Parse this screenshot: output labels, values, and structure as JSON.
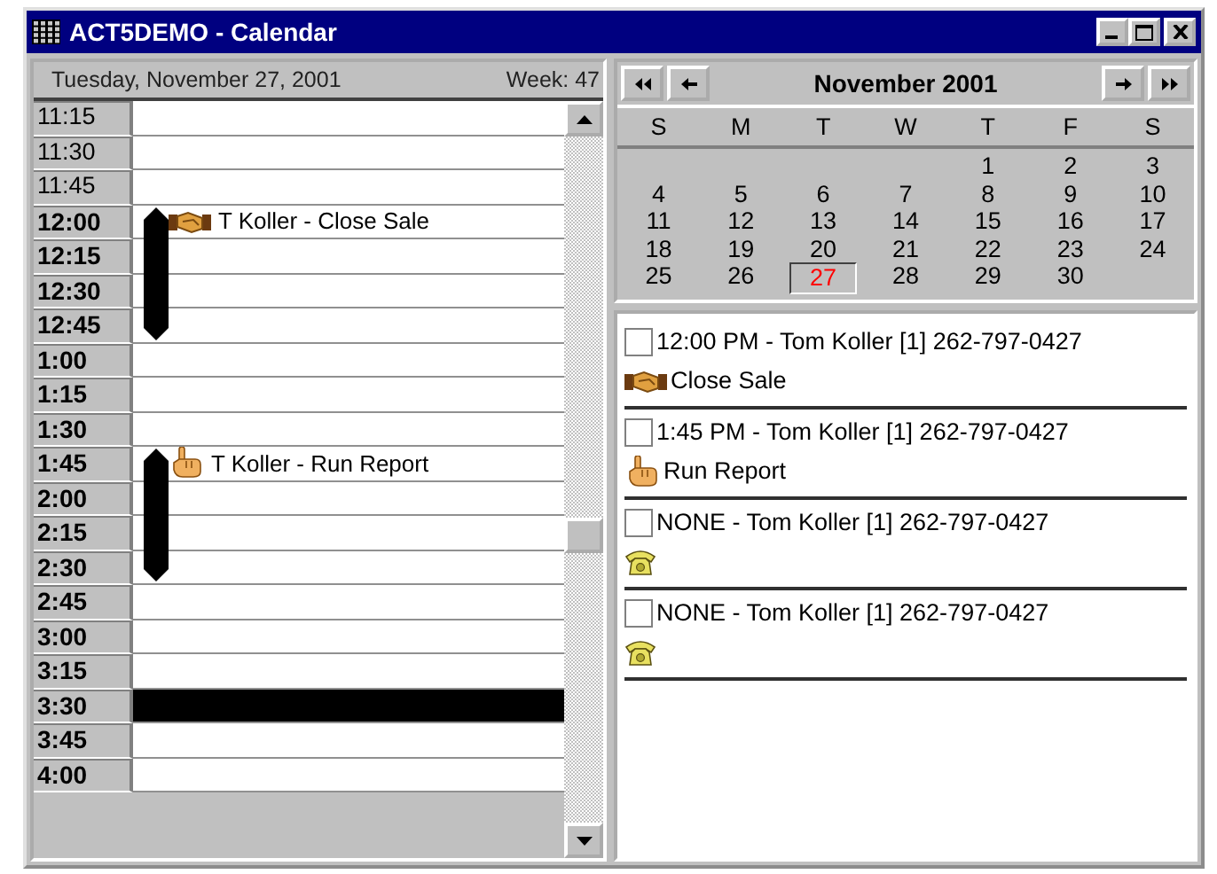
{
  "window": {
    "title": "ACT5DEMO - Calendar"
  },
  "day_view": {
    "date": "Tuesday, November 27, 2001",
    "week": "Week: 47",
    "slots": [
      {
        "time": "11:15",
        "work_hours": false,
        "busy": false,
        "selected": false
      },
      {
        "time": "11:30",
        "work_hours": false,
        "busy": false,
        "selected": false
      },
      {
        "time": "11:45",
        "work_hours": false,
        "busy": false,
        "selected": false
      },
      {
        "time": "12:00",
        "work_hours": true,
        "busy": true,
        "selected": false,
        "appointment": {
          "kind": "sale",
          "label": "T Koller - Close Sale"
        }
      },
      {
        "time": "12:15",
        "work_hours": true,
        "busy": true,
        "selected": false
      },
      {
        "time": "12:30",
        "work_hours": true,
        "busy": true,
        "selected": false
      },
      {
        "time": "12:45",
        "work_hours": true,
        "busy": true,
        "selected": false
      },
      {
        "time": "1:00",
        "work_hours": true,
        "busy": false,
        "selected": false
      },
      {
        "time": "1:15",
        "work_hours": true,
        "busy": false,
        "selected": false
      },
      {
        "time": "1:30",
        "work_hours": true,
        "busy": false,
        "selected": false
      },
      {
        "time": "1:45",
        "work_hours": true,
        "busy": true,
        "selected": false,
        "appointment": {
          "kind": "report",
          "label": "T Koller - Run Report"
        }
      },
      {
        "time": "2:00",
        "work_hours": true,
        "busy": true,
        "selected": false
      },
      {
        "time": "2:15",
        "work_hours": true,
        "busy": true,
        "selected": false
      },
      {
        "time": "2:30",
        "work_hours": true,
        "busy": true,
        "selected": false
      },
      {
        "time": "2:45",
        "work_hours": true,
        "busy": false,
        "selected": false
      },
      {
        "time": "3:00",
        "work_hours": true,
        "busy": false,
        "selected": false
      },
      {
        "time": "3:15",
        "work_hours": true,
        "busy": false,
        "selected": false
      },
      {
        "time": "3:30",
        "work_hours": true,
        "busy": false,
        "selected": true
      },
      {
        "time": "3:45",
        "work_hours": true,
        "busy": false,
        "selected": false
      },
      {
        "time": "4:00",
        "work_hours": true,
        "busy": false,
        "selected": false
      }
    ]
  },
  "month_view": {
    "title": "November 2001",
    "weekdays": [
      "S",
      "M",
      "T",
      "W",
      "T",
      "F",
      "S"
    ],
    "weeks": [
      {
        "days": [
          {
            "day": "1",
            "selected": false
          },
          {
            "day": "2",
            "selected": false
          },
          {
            "day": "3",
            "selected": false
          }
        ]
      },
      {
        "days": [
          {
            "day": "4",
            "selected": false
          },
          {
            "day": "5",
            "selected": false
          },
          {
            "day": "6",
            "selected": false
          },
          {
            "day": "7",
            "selected": false
          },
          {
            "day": "8",
            "selected": false
          },
          {
            "day": "9",
            "selected": false
          },
          {
            "day": "10",
            "selected": false
          }
        ]
      },
      {
        "days": [
          {
            "day": "11",
            "selected": false
          },
          {
            "day": "12",
            "selected": false
          },
          {
            "day": "13",
            "selected": false
          },
          {
            "day": "14",
            "selected": false
          },
          {
            "day": "15",
            "selected": false
          },
          {
            "day": "16",
            "selected": false
          },
          {
            "day": "17",
            "selected": false
          }
        ]
      },
      {
        "days": [
          {
            "day": "18",
            "selected": false
          },
          {
            "day": "19",
            "selected": false
          },
          {
            "day": "20",
            "selected": false
          },
          {
            "day": "21",
            "selected": false
          },
          {
            "day": "22",
            "selected": false
          },
          {
            "day": "23",
            "selected": false
          },
          {
            "day": "24",
            "selected": false
          }
        ]
      },
      {
        "days": [
          {
            "day": "25",
            "selected": false
          },
          {
            "day": "26",
            "selected": false
          },
          {
            "day": "27",
            "selected": true
          },
          {
            "day": "28",
            "selected": false
          },
          {
            "day": "29",
            "selected": false
          },
          {
            "day": "30",
            "selected": false
          }
        ]
      }
    ]
  },
  "task_list": [
    {
      "checked": false,
      "heading": "12:00 PM - Tom Koller [1] 262-797-0427",
      "kind": "sale",
      "label": "Close Sale"
    },
    {
      "checked": false,
      "heading": "1:45 PM - Tom Koller [1] 262-797-0427",
      "kind": "report",
      "label": "Run Report"
    },
    {
      "checked": false,
      "heading": "NONE - Tom Koller [1] 262-797-0427",
      "kind": "call"
    },
    {
      "checked": false,
      "heading": "NONE - Tom Koller [1] 262-797-0427",
      "kind": "call"
    }
  ]
}
